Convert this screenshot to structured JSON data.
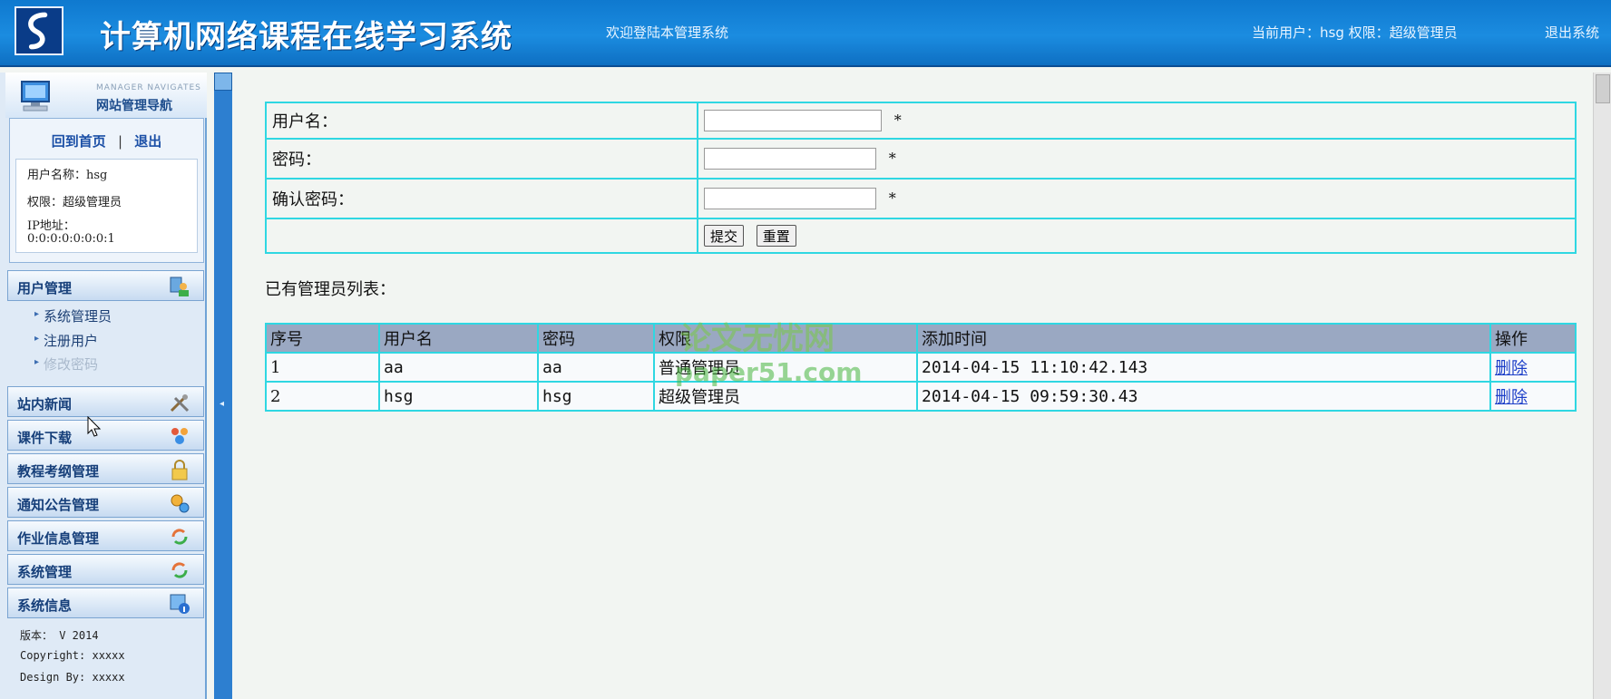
{
  "header": {
    "title": "计算机网络课程在线学习系统",
    "welcome": "欢迎登陆本管理系统",
    "current_user": "当前用户：hsg 权限：超级管理员",
    "logout": "退出系统"
  },
  "sidebar": {
    "nav_en": "MANAGER NAVIGATES",
    "nav_cn": "网站管理导航",
    "home_link": "回到首页",
    "separator": "|",
    "exit_link": "退出",
    "user_name": "用户名称：hsg",
    "role": "权限：超级管理员",
    "ip_label": "IP地址：",
    "ip_value": "0:0:0:0:0:0:0:1",
    "menu": [
      {
        "label": "用户管理",
        "icon": "users-icon"
      },
      {
        "label": "站内新闻",
        "icon": "tools-icon"
      },
      {
        "label": "课件下载",
        "icon": "group-icon"
      },
      {
        "label": "教程考纲管理",
        "icon": "lock-icon"
      },
      {
        "label": "通知公告管理",
        "icon": "gears-icon"
      },
      {
        "label": "作业信息管理",
        "icon": "refresh-icon"
      },
      {
        "label": "系统管理",
        "icon": "refresh-icon"
      },
      {
        "label": "系统信息",
        "icon": "info-icon"
      }
    ],
    "submenu": [
      "系统管理员",
      "注册用户",
      "修改密码"
    ],
    "version": "版本： V 2014",
    "copyright": "Copyright: xxxxx",
    "design": "Design By:  xxxxx"
  },
  "form": {
    "username_label": "用户名：",
    "password_label": "密码：",
    "confirm_label": "确认密码：",
    "required_mark": "*",
    "submit_label": "提交",
    "reset_label": "重置"
  },
  "list": {
    "title": "已有管理员列表：",
    "headers": [
      "序号",
      "用户名",
      "密码",
      "权限",
      "添加时间",
      "操作"
    ],
    "rows": [
      [
        "1",
        "aa",
        "aa",
        "普通管理员",
        "2014-04-15 11:10:42.143",
        "删除"
      ],
      [
        "2",
        "hsg",
        "hsg",
        "超级管理员",
        "2014-04-15 09:59:30.43",
        "删除"
      ]
    ]
  },
  "watermark": {
    "cn": "论文无忧网",
    "en": "paper51.com"
  },
  "colors": {
    "header_blue": "#1b8ce0",
    "table_border": "#2fd7e2",
    "table_header": "#9aa8c2"
  }
}
